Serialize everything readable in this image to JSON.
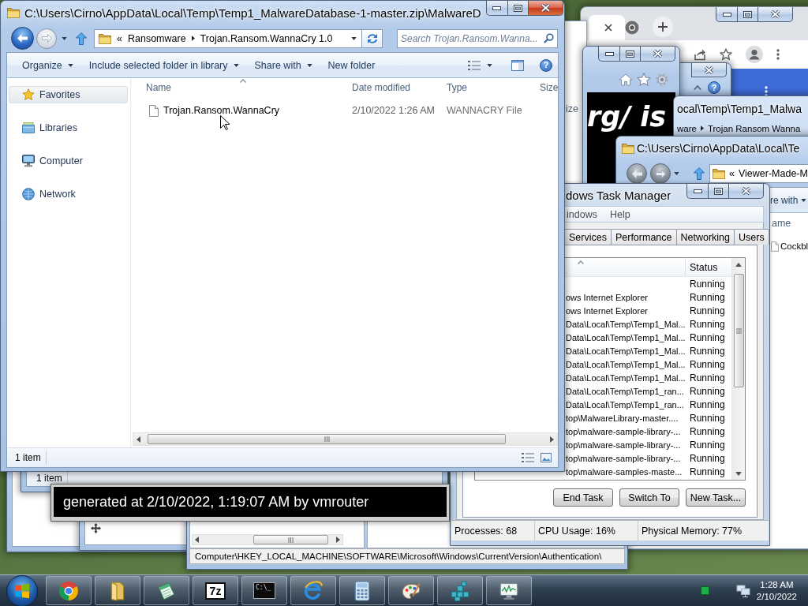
{
  "explorer_window": {
    "active": true,
    "title": "C:\\Users\\Cirno\\AppData\\Local\\Temp\\Temp1_MalwareDatabase-1-master.zip\\MalwareD",
    "address": {
      "overflow": "«",
      "crumbs": [
        "Ransomware",
        "Trojan.Ransom.WannaCry 1.0"
      ]
    },
    "search": {
      "placeholder": "Search Trojan.Ransom.Wanna..."
    },
    "toolbar": [
      {
        "label": "Organize",
        "dropdown": true
      },
      {
        "label": "Include selected folder in library",
        "dropdown": true
      },
      {
        "label": "Share with",
        "dropdown": true
      },
      {
        "label": "New folder",
        "dropdown": false
      }
    ],
    "help": "?",
    "sidebar": [
      {
        "label": "Favorites",
        "selected": true
      },
      {
        "label": "Libraries",
        "selected": false
      },
      {
        "label": "Computer",
        "selected": false
      },
      {
        "label": "Network",
        "selected": false
      }
    ],
    "columns": [
      "Name",
      "Date modified",
      "Type",
      "Size"
    ],
    "files": [
      {
        "name": "Trojan.Ransom.WannaCry",
        "date_modified": "2/10/2022 1:26 AM",
        "type": "WANNACRY File"
      }
    ],
    "status": "1 item"
  },
  "side_window": {
    "column": "ize"
  },
  "small_window": {
    "help": "?"
  },
  "ie_window": {
    "page_text": "rg/ is"
  },
  "explorer_back": {
    "title": "ocal\\Temp\\Temp1_Malwa",
    "crumbs": [
      "ware",
      "Trojan Ransom Wanna"
    ]
  },
  "explorer_right": {
    "title": "C:\\Users\\Cirno\\AppData\\Local\\Te",
    "address": {
      "overflow": "«",
      "crumbs": [
        "Viewer-Made-M"
      ]
    },
    "toolbar": [
      {
        "label": "re with",
        "dropdown": true
      }
    ],
    "column": "ame",
    "files": [
      "Cockbl"
    ]
  },
  "task_manager": {
    "active": false,
    "title": "dows Task Manager",
    "menu": [
      "indows",
      "Help"
    ],
    "tabs": [
      {
        "label": "Services",
        "selected": false
      },
      {
        "label": "Performance",
        "selected": false
      },
      {
        "label": "Networking",
        "selected": false
      },
      {
        "label": "Users",
        "selected": false
      }
    ],
    "columns": [
      "Status"
    ],
    "tasks": [
      {
        "status": "Running"
      },
      {
        "task": "ows Internet Explorer",
        "status": "Running"
      },
      {
        "task": "ows Internet Explorer",
        "status": "Running"
      },
      {
        "task": "Data\\Local\\Temp\\Temp1_Mal...",
        "status": "Running"
      },
      {
        "task": "Data\\Local\\Temp\\Temp1_Mal...",
        "status": "Running"
      },
      {
        "task": "Data\\Local\\Temp\\Temp1_Mal...",
        "status": "Running"
      },
      {
        "task": "Data\\Local\\Temp\\Temp1_Mal...",
        "status": "Running"
      },
      {
        "task": "Data\\Local\\Temp\\Temp1_Mal...",
        "status": "Running"
      },
      {
        "task": "Data\\Local\\Temp\\Temp1_ran...",
        "status": "Running"
      },
      {
        "task": "Data\\Local\\Temp\\Temp1_ran...",
        "status": "Running"
      },
      {
        "task": "top\\MalwareLibrary-master....",
        "status": "Running"
      },
      {
        "task": "top\\malware-sample-library-...",
        "status": "Running"
      },
      {
        "task": "top\\malware-sample-library-...",
        "status": "Running"
      },
      {
        "task": "top\\malware-sample-library-...",
        "status": "Running"
      },
      {
        "task": "top\\malware-samples-maste...",
        "status": "Running"
      }
    ],
    "buttons": [
      "End Task",
      "Switch To",
      "New Task..."
    ],
    "status_bar": [
      "Processes: 68",
      "CPU Usage: 16%",
      "Physical Memory: 77%"
    ]
  },
  "status_window": {
    "status": "1 item"
  },
  "banner_window": {
    "text": "generated at 2/10/2022, 1:19:07 AM by vmrouter"
  },
  "registry_window": {
    "path": "Computer\\HKEY_LOCAL_MACHINE\\SOFTWARE\\Microsoft\\Windows\\CurrentVersion\\Authentication\\"
  },
  "taskbar": {
    "items": [
      {
        "kind": "browser"
      },
      {
        "kind": "folder"
      },
      {
        "kind": "notebook"
      },
      {
        "kind": "archive",
        "label": "7z"
      },
      {
        "kind": "console",
        "label": "C:\\_"
      },
      {
        "kind": "web"
      },
      {
        "kind": "calculator"
      },
      {
        "kind": "paint"
      },
      {
        "kind": "registry"
      },
      {
        "kind": "monitor"
      }
    ],
    "clock": {
      "time": "1:28 AM",
      "date": "2/10/2022"
    }
  }
}
